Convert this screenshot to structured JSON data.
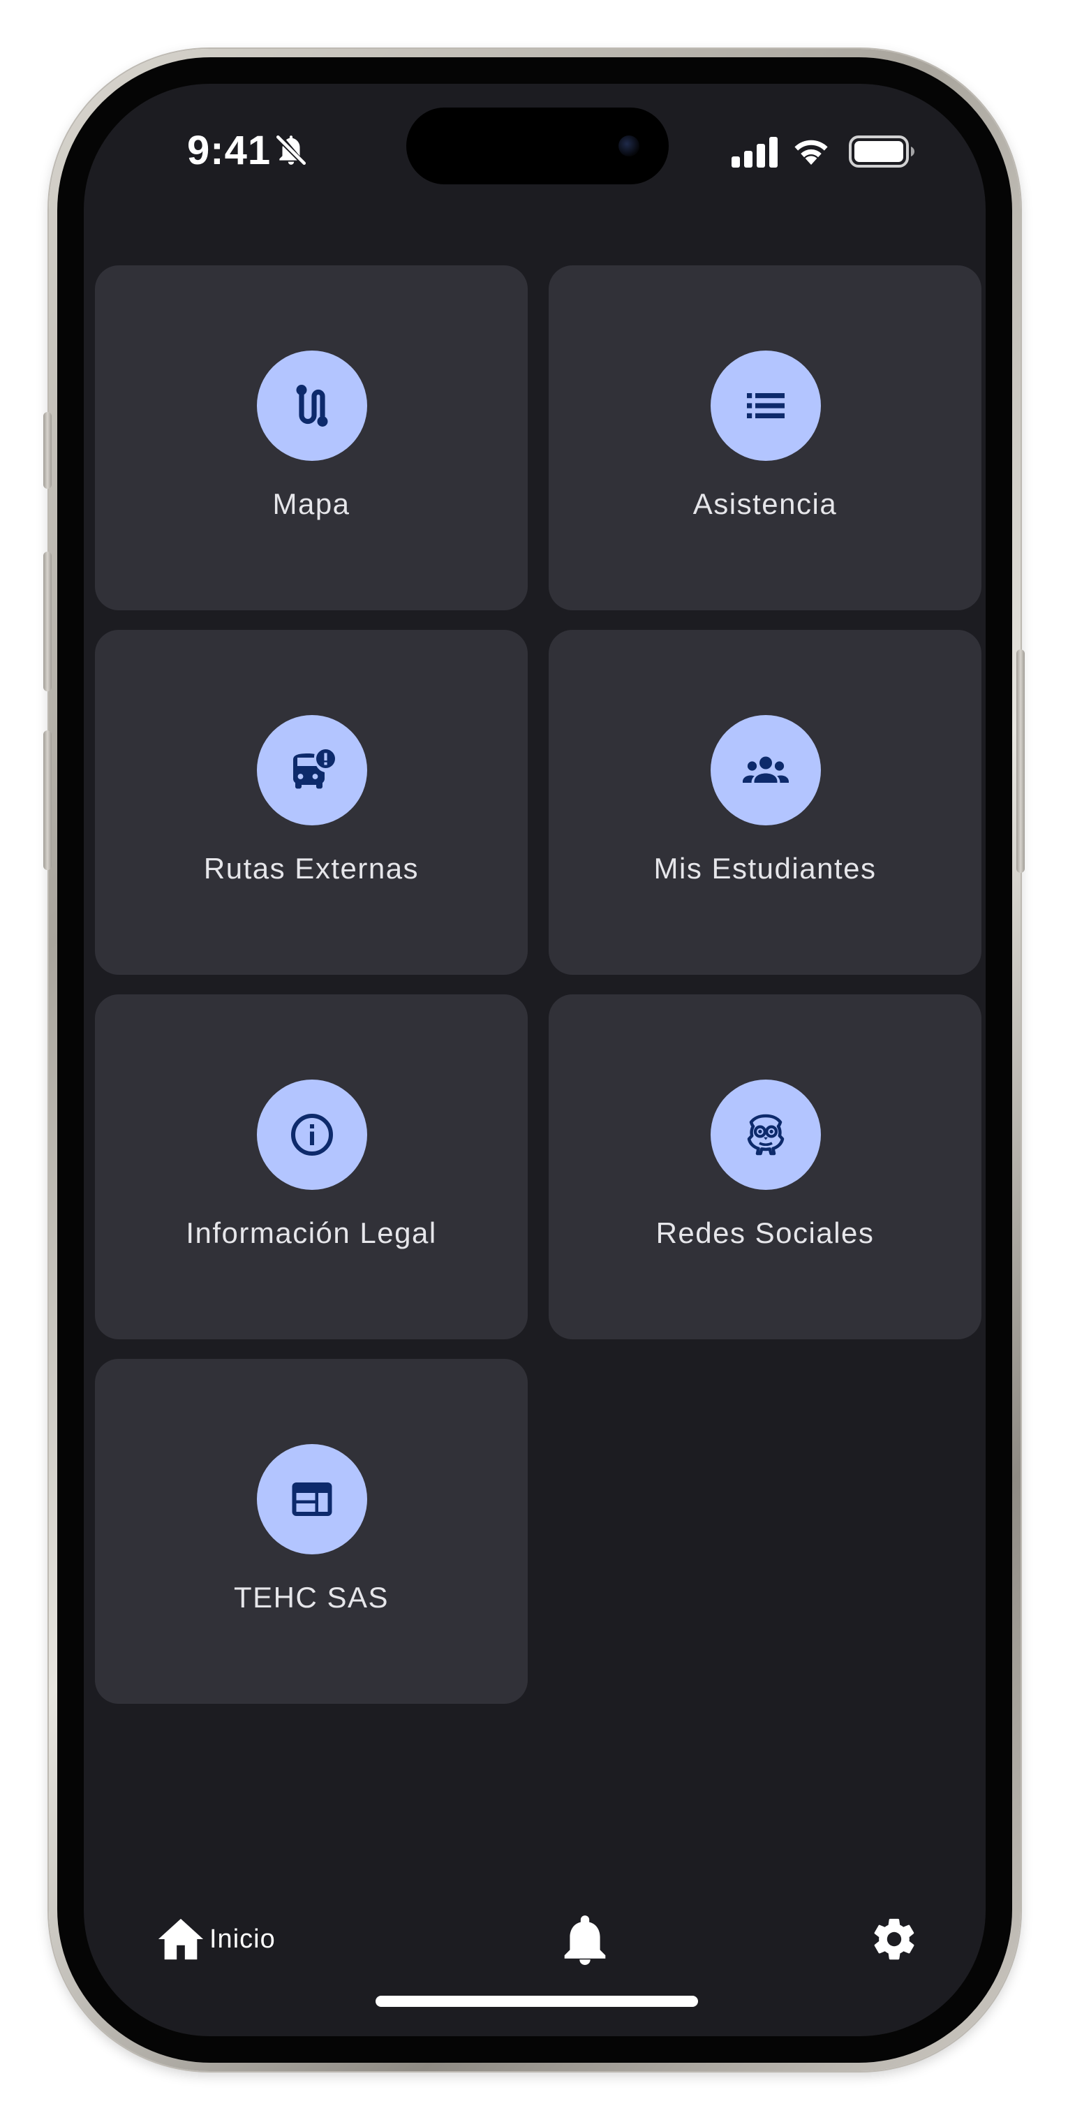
{
  "status_bar": {
    "time": "9:41",
    "icons": [
      "bell-slash-icon",
      "cellular-signal-icon",
      "wifi-icon",
      "battery-icon"
    ]
  },
  "menu": {
    "tiles": [
      {
        "label": "Mapa",
        "icon": "route-icon"
      },
      {
        "label": "Asistencia",
        "icon": "list-icon"
      },
      {
        "label": "Rutas Externas",
        "icon": "bus-alert-icon"
      },
      {
        "label": "Mis Estudiantes",
        "icon": "group-icon"
      },
      {
        "label": "Información Legal",
        "icon": "info-icon"
      },
      {
        "label": "Redes Sociales",
        "icon": "owl-mascot-icon"
      },
      {
        "label": "TEHC SAS",
        "icon": "web-window-icon"
      }
    ]
  },
  "bottom_nav": {
    "home_label": "Inicio",
    "items": [
      "home-icon",
      "bell-icon",
      "gear-icon"
    ]
  },
  "colors": {
    "screen_bg": "#1c1c21",
    "tile_bg": "#313138",
    "icon_circle": "#b3c5ff",
    "icon_glyph": "#0d2a6b",
    "text": "#e6e6ea"
  }
}
